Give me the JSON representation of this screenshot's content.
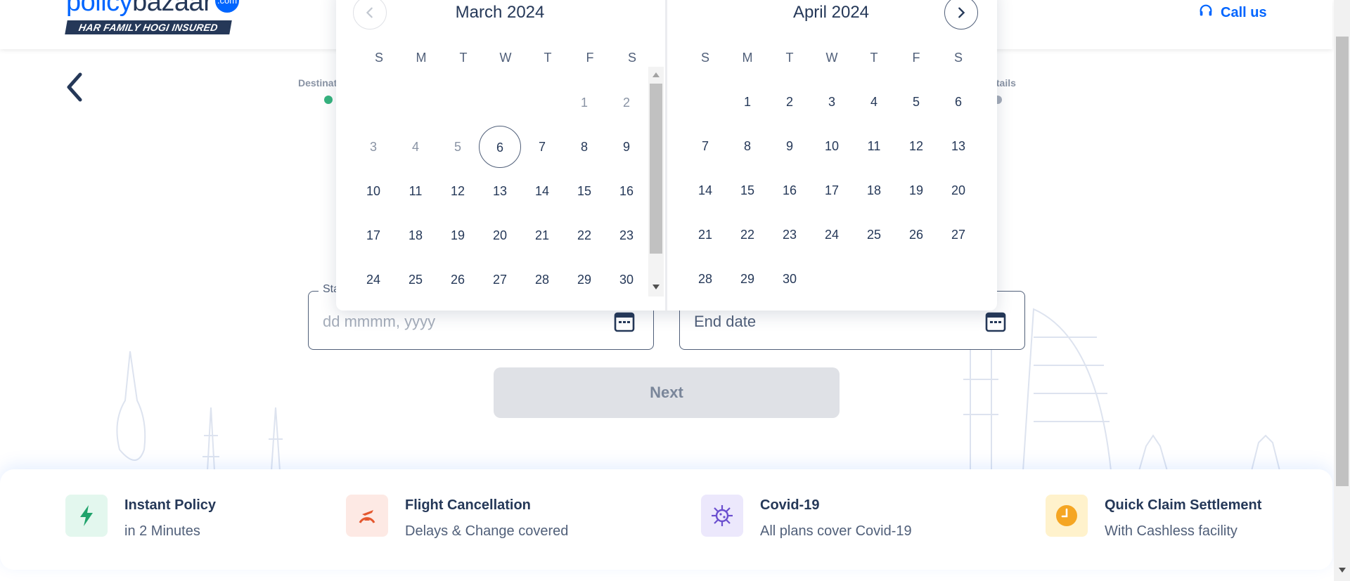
{
  "header": {
    "logo_text_a": "policy",
    "logo_text_b": "bazaar",
    "logo_badge": ".com",
    "logo_tagline": "HAR FAMILY HOGI INSURED",
    "call_us_label": "Call us"
  },
  "progress": {
    "step_left_label": "Destinat",
    "step_right_label": "t details"
  },
  "form": {
    "start_label": "Sta",
    "start_placeholder": "dd mmmm, yyyy",
    "end_placeholder": "End date",
    "next_label": "Next"
  },
  "calendar": {
    "weekdays": [
      "S",
      "M",
      "T",
      "W",
      "T",
      "F",
      "S"
    ],
    "left_month": {
      "title": "March 2024",
      "first_weekday": 5,
      "days_shown": 30,
      "today": 6,
      "past_until": 5
    },
    "right_month": {
      "title": "April 2024",
      "first_weekday": 1,
      "days_shown": 30
    }
  },
  "features": [
    {
      "title": "Instant Policy",
      "subtitle": "in 2 Minutes",
      "icon": "lightning-icon",
      "bg": "#e3f7ee",
      "color": "#1fa36b"
    },
    {
      "title": "Flight Cancellation",
      "subtitle": "Delays & Change covered",
      "icon": "flight-cancel-icon",
      "bg": "#fde9e4",
      "color": "#e4572e"
    },
    {
      "title": "Covid-19",
      "subtitle": "All plans cover Covid-19",
      "icon": "virus-icon",
      "bg": "#ece8fc",
      "color": "#6b4fcf"
    },
    {
      "title": "Quick Claim Settlement",
      "subtitle": "With Cashless facility",
      "icon": "clock-icon",
      "bg": "#fff2cc",
      "color": "#f5a623"
    }
  ],
  "colors": {
    "brand": "#0065ff",
    "navy": "#253858",
    "step_done": "#36b37e",
    "step_pending": "#a5adba"
  }
}
